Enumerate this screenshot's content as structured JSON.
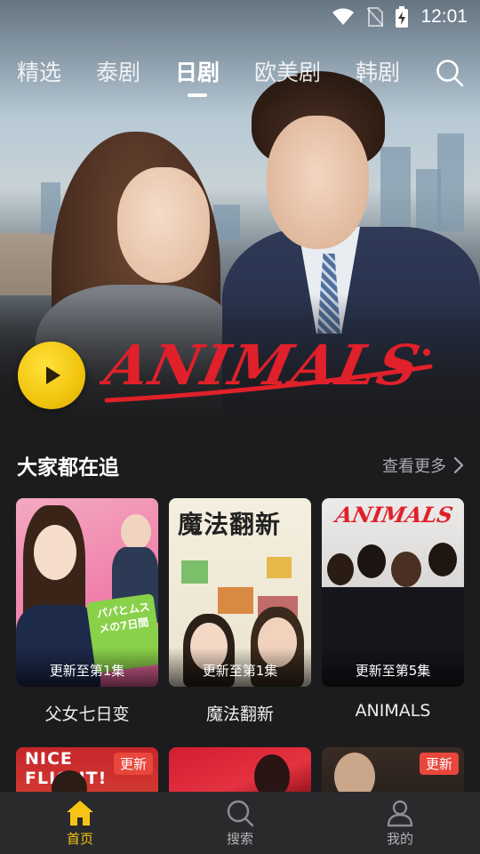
{
  "status_bar": {
    "time": "12:01"
  },
  "top_tabs": [
    {
      "label": "精选",
      "active": false
    },
    {
      "label": "泰剧",
      "active": false
    },
    {
      "label": "日剧",
      "active": true
    },
    {
      "label": "欧美剧",
      "active": false
    },
    {
      "label": "韩剧",
      "active": false
    }
  ],
  "hero": {
    "logo_text": "ANIMALS"
  },
  "section": {
    "title": "大家都在追",
    "more_label": "查看更多"
  },
  "cards": [
    {
      "title": "父女七日变",
      "progress": "更新至第1集",
      "poster_text": "パパとムスメの7日間"
    },
    {
      "title": "魔法翻新",
      "progress": "更新至第1集",
      "poster_text": "魔法翻新"
    },
    {
      "title": "ANIMALS",
      "progress": "更新至第5集",
      "poster_text": "ANIMALS"
    }
  ],
  "next_row": [
    {
      "badge": "更新",
      "poster_text": "NICE FLIGHT!"
    },
    {
      "badge": ""
    },
    {
      "badge": "更新"
    }
  ],
  "bottom_nav": [
    {
      "label": "首页",
      "icon": "home-icon",
      "active": true
    },
    {
      "label": "搜索",
      "icon": "search-icon",
      "active": false
    },
    {
      "label": "我的",
      "icon": "user-icon",
      "active": false
    }
  ],
  "colors": {
    "accent": "#f6c514",
    "badge": "#e9463c",
    "background": "#1c1c1e",
    "nav": "#2a2a2c",
    "logo_red": "#e0202a"
  }
}
